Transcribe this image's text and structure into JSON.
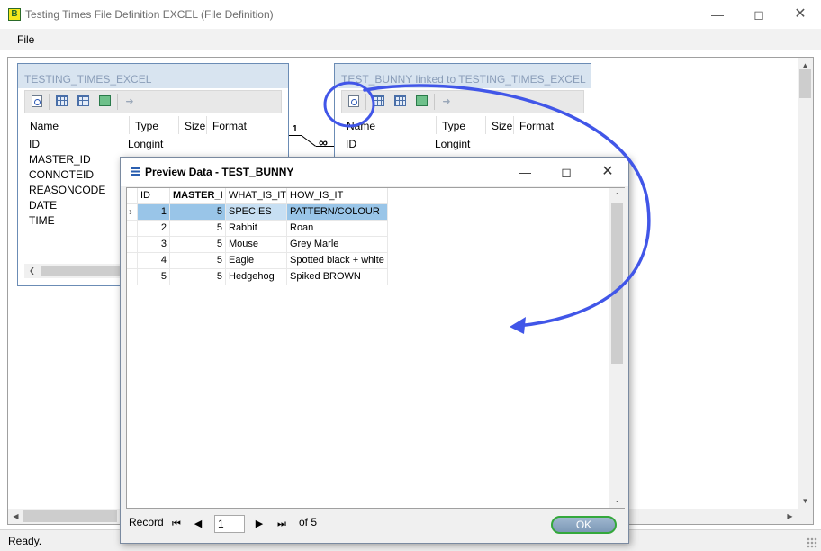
{
  "window": {
    "title": "Testing Times File Definition EXCEL (File Definition)",
    "app_icon_letter": "B"
  },
  "menu": {
    "file": "File"
  },
  "status": {
    "text": "Ready."
  },
  "left_panel": {
    "title": "TESTING_TIMES_EXCEL",
    "columns": [
      "Name",
      "Type",
      "Size",
      "Format"
    ],
    "fields": [
      {
        "name": "ID",
        "type": "Longint"
      },
      {
        "name": "MASTER_ID",
        "type": ""
      },
      {
        "name": "CONNOTEID",
        "type": ""
      },
      {
        "name": "REASONCODE",
        "type": ""
      },
      {
        "name": "DATE",
        "type": ""
      },
      {
        "name": "TIME",
        "type": ""
      }
    ]
  },
  "right_panel": {
    "title": "TEST_BUNNY linked to TESTING_TIMES_EXCEL",
    "columns": [
      "Name",
      "Type",
      "Size",
      "Format"
    ],
    "fields": [
      {
        "name": "ID",
        "type": "Longint"
      }
    ]
  },
  "relation": {
    "one": "1",
    "many": "∞"
  },
  "preview": {
    "title": "Preview Data - TEST_BUNNY",
    "headers": [
      "ID",
      "MASTER_I",
      "WHAT_IS_IT",
      "HOW_IS_IT"
    ],
    "rows": [
      [
        "1",
        "5",
        "SPECIES",
        "PATTERN/COLOUR"
      ],
      [
        "2",
        "5",
        "Rabbit",
        "Roan"
      ],
      [
        "3",
        "5",
        "Mouse",
        "Grey Marle"
      ],
      [
        "4",
        "5",
        "Eagle",
        "Spotted black + white"
      ],
      [
        "5",
        "5",
        "Hedgehog",
        "Spiked BROWN"
      ]
    ],
    "record_label": "Record",
    "record_value": "1",
    "of_label": "of 5",
    "ok_label": "OK"
  },
  "annotation": {
    "color": "#4156e8"
  },
  "icons": [
    "minimize-icon",
    "maximize-icon",
    "close-icon",
    "preview-icon",
    "grid-icon",
    "calc-icon",
    "exit-icon",
    "first-record-icon",
    "prev-record-icon",
    "next-record-icon",
    "last-record-icon"
  ]
}
